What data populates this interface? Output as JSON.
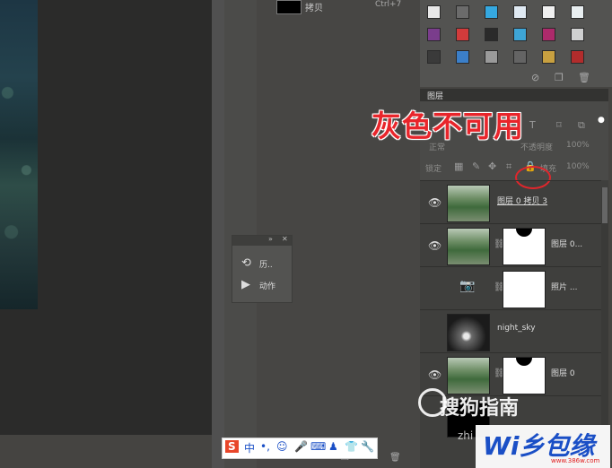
{
  "top_strip": {
    "layer_label": "拷贝",
    "shortcut": "Ctrl+7"
  },
  "mini_panel": {
    "head_icons": [
      "expand-icon",
      "close-icon"
    ],
    "items": [
      {
        "icon": "history-icon",
        "label": "历.."
      },
      {
        "icon": "play-icon",
        "label": "动作"
      }
    ]
  },
  "swatches": {
    "colors": [
      [
        "#e8e8e8",
        "#6b6b6b",
        "#35a8e0",
        "#dfe9f2",
        "#f0f0f0",
        "#e8eef0"
      ],
      [
        "#7a3d8c",
        "#d23b3b",
        "#2a2a2a",
        "#3ea5d6",
        "#ad2a6b",
        "#cfd0d0"
      ],
      [
        "#3a3a3a",
        "#3b7fc9",
        "#9a9a9a",
        "#646464",
        "#c8a040",
        "#b22c2c"
      ]
    ],
    "footer_icons": [
      "no-icon",
      "new-icon",
      "trash-icon"
    ]
  },
  "layers_panel": {
    "tab_label": "图层",
    "blend_mode": "正常",
    "opacity_label": "不透明度",
    "opacity_value": "100%",
    "lock_label": "锁定",
    "fill_label": "填充",
    "fill_value": "100%",
    "layers": [
      {
        "name": "图层 0 拷贝 3",
        "thumb": "forest",
        "mask": false,
        "adjustment": false
      },
      {
        "name": "图层 0...",
        "thumb": "forest",
        "mask": true,
        "adjustment": false
      },
      {
        "name": "照片 ...",
        "thumb": "camera",
        "mask": true,
        "adjustment": true
      },
      {
        "name": "night_sky",
        "thumb": "sky",
        "mask": false,
        "adjustment": false
      },
      {
        "name": "图层 0",
        "thumb": "forest",
        "mask": true,
        "adjustment": false
      }
    ],
    "footer_icons": [
      "new-icon",
      "trash-icon"
    ]
  },
  "annotation": {
    "text": "灰色不可用",
    "color": "#e8252b"
  },
  "ime_bar": {
    "items": [
      "S",
      "中",
      "•,",
      "☺",
      "🎤",
      "⌨",
      "♟",
      "👕",
      "🔧"
    ]
  },
  "watermarks": {
    "sogou": "搜狗指南",
    "zhi": "zhi",
    "site_logo": "Wi乡包缘",
    "site_url": "www.386w.com"
  }
}
